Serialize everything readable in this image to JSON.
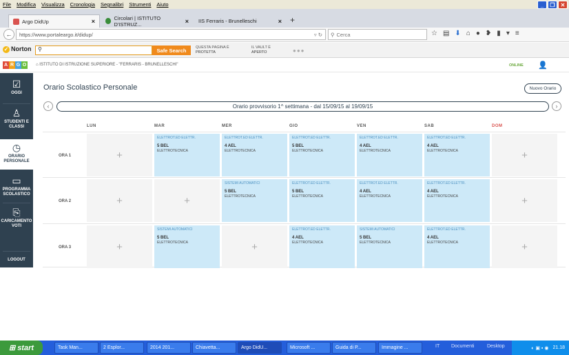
{
  "menu": [
    "File",
    "Modifica",
    "Visualizza",
    "Cronologia",
    "Segnalibri",
    "Strumenti",
    "Aiuto"
  ],
  "tabs": [
    {
      "label": "Argo DidUp",
      "close": "×"
    },
    {
      "label": "Circolari | ISTITUTO D'ISTRUZ...",
      "close": "×"
    },
    {
      "label": "IIS Ferraris - Brunelleschi",
      "close": "×"
    }
  ],
  "newtab": "+",
  "nav": {
    "url": "https://www.portaleargo.it/didup/",
    "search_placeholder": "Cerca"
  },
  "norton": {
    "brand": "Norton",
    "safe_search": "Safe Search",
    "protected_l1": "QUESTA PAGINA È",
    "protected_l2": "PROTETTA",
    "vault_l1": "IL VAULT È",
    "vault_l2": "APERTO",
    "dots": "●●●"
  },
  "argo": {
    "logo_letters": [
      "A",
      "R",
      "G",
      "O"
    ],
    "logo_colors": [
      "#e04b3a",
      "#f0a21c",
      "#4aa3df",
      "#6bbf3b"
    ],
    "school": "ISTITUTO DI ISTRUZIONE SUPERIORE - \"FERRARIS - BRUNELLESCHI\"",
    "status": "ONLINE"
  },
  "sidebar": [
    {
      "l1": "OGGI",
      "l2": ""
    },
    {
      "l1": "STUDENTI E",
      "l2": "CLASSI"
    },
    {
      "l1": "ORARIO",
      "l2": "PERSONALE"
    },
    {
      "l1": "PROGRAMMA",
      "l2": "SCOLASTICO"
    },
    {
      "l1": "CARICAMENTO",
      "l2": "VOTI"
    },
    {
      "l1": "LOGOUT",
      "l2": ""
    }
  ],
  "main": {
    "title": "Orario Scolastico Personale",
    "new_button": "Nuovo Orario",
    "week": "Orario provvisorio 1^ settimana - dal 15/09/15 al 19/09/15",
    "prev": "‹",
    "next": "›",
    "days": [
      "LUN",
      "MAR",
      "MER",
      "GIO",
      "VEN",
      "SAB",
      "DOM"
    ],
    "rows": [
      "ORA 1",
      "ORA 2",
      "ORA 3"
    ],
    "plus": "+",
    "grid": [
      [
        null,
        {
          "subj": "ELETTROT.ED ELETTR.",
          "cls": "5 BEL",
          "spec": "ELETTROTECNICA"
        },
        {
          "subj": "ELETTROT.ED ELETTR.",
          "cls": "4 AEL",
          "spec": "ELETTROTECNICA"
        },
        {
          "subj": "ELETTROT.ED ELETTR.",
          "cls": "5 BEL",
          "spec": "ELETTROTECNICA"
        },
        {
          "subj": "ELETTROT.ED ELETTR.",
          "cls": "4 AEL",
          "spec": "ELETTROTECNICA"
        },
        {
          "subj": "ELETTROT.ED ELETTR.",
          "cls": "4 AEL",
          "spec": "ELETTROTECNICA"
        },
        null
      ],
      [
        null,
        null,
        {
          "subj": "SISTEMI AUTOMATICI",
          "cls": "5 BEL",
          "spec": "ELETTROTECNICA"
        },
        {
          "subj": "ELETTROT.ED ELETTR.",
          "cls": "5 BEL",
          "spec": "ELETTROTECNICA"
        },
        {
          "subj": "ELETTROT.ED ELETTR.",
          "cls": "4 AEL",
          "spec": "ELETTROTECNICA"
        },
        {
          "subj": "ELETTROT.ED ELETTR.",
          "cls": "4 AEL",
          "spec": "ELETTROTECNICA"
        },
        null
      ],
      [
        null,
        {
          "subj": "SISTEMI AUTOMATICI",
          "cls": "5 BEL",
          "spec": "ELETTROTECNICA"
        },
        null,
        {
          "subj": "ELETTROT.ED ELETTR.",
          "cls": "4 AEL",
          "spec": "ELETTROTECNICA"
        },
        {
          "subj": "SISTEMI AUTOMATICI",
          "cls": "5 BEL",
          "spec": "ELETTROTECNICA"
        },
        {
          "subj": "ELETTROT.ED ELETTR.",
          "cls": "4 AEL",
          "spec": "ELETTROTECNICA"
        },
        null
      ]
    ]
  },
  "taskbar": {
    "start": "start",
    "items": [
      "Task Man...",
      "2 Esplor...",
      "2014 201...",
      "Chiavetta...",
      "Argo DidU...",
      "Microsoft ...",
      "Guida di P...",
      "Immagine ..."
    ],
    "lang": "IT",
    "documents": "Documenti",
    "desktop": "Desktop",
    "clock": "21.18"
  },
  "colors": {
    "sidebar": "#2f4150",
    "cell_full": "#cde9f8",
    "cell_empty": "#f4f4f4",
    "dom_header": "#d9534f"
  }
}
